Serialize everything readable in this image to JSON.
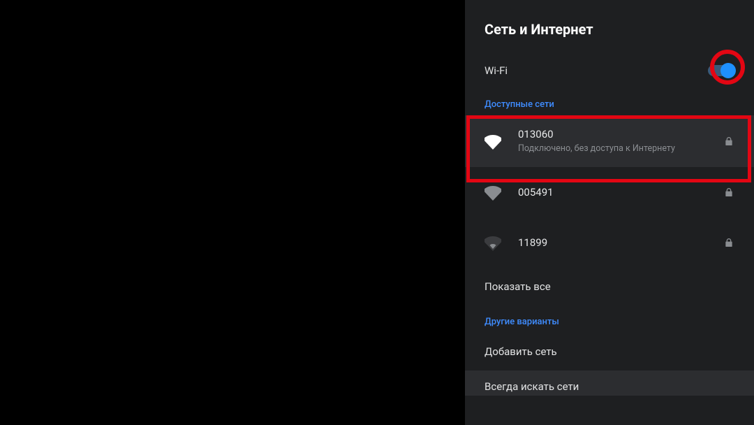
{
  "header": {
    "title": "Сеть и Интернет"
  },
  "wifi": {
    "label": "Wi-Fi",
    "enabled": true
  },
  "sections": {
    "available_label": "Доступные сети",
    "other_label": "Другие варианты"
  },
  "networks": [
    {
      "name": "013060",
      "sub": "Подключено, без доступа к Интернету",
      "signal": "full",
      "locked": true,
      "selected": true
    },
    {
      "name": "005491",
      "sub": "",
      "signal": "full-gray",
      "locked": true,
      "selected": false
    },
    {
      "name": "11899",
      "sub": "",
      "signal": "weak-gray",
      "locked": true,
      "selected": false
    }
  ],
  "actions": {
    "show_all": "Показать все",
    "add_network": "Добавить сеть",
    "always_search": "Всегда искать сети"
  },
  "annotations": {
    "ring_toggle": true,
    "box_first_network": true
  },
  "colors": {
    "accent": "#1e90ff",
    "highlight": "#e30613",
    "link": "#3f8cff"
  }
}
